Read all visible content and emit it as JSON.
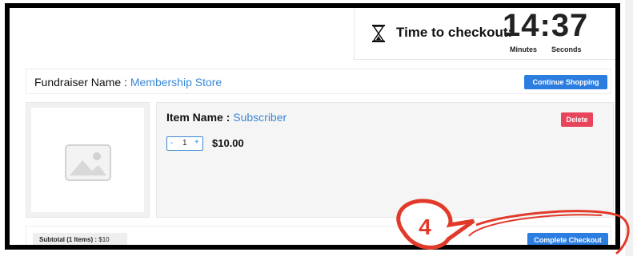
{
  "timer": {
    "label": "Time to checkout:",
    "value": "14:37",
    "minutes_label": "Minutes",
    "seconds_label": "Seconds"
  },
  "fundraiser": {
    "label": "Fundraiser Name : ",
    "name": "Membership Store",
    "continue_label": "Continue Shopping"
  },
  "item": {
    "label": "Item Name : ",
    "name": "Subscriber",
    "delete_label": "Delete",
    "minus": "-",
    "quantity": "1",
    "plus": "+",
    "price": "$10.00"
  },
  "footer": {
    "subtotal_label": "Subtotal (1 Items) :",
    "subtotal_value": "$10",
    "complete_label": "Complete Checkout"
  },
  "annotation": {
    "step": "4",
    "color": "#e23a2a"
  },
  "icons": {
    "timer": "hourglass-icon",
    "image": "image-placeholder-icon"
  }
}
